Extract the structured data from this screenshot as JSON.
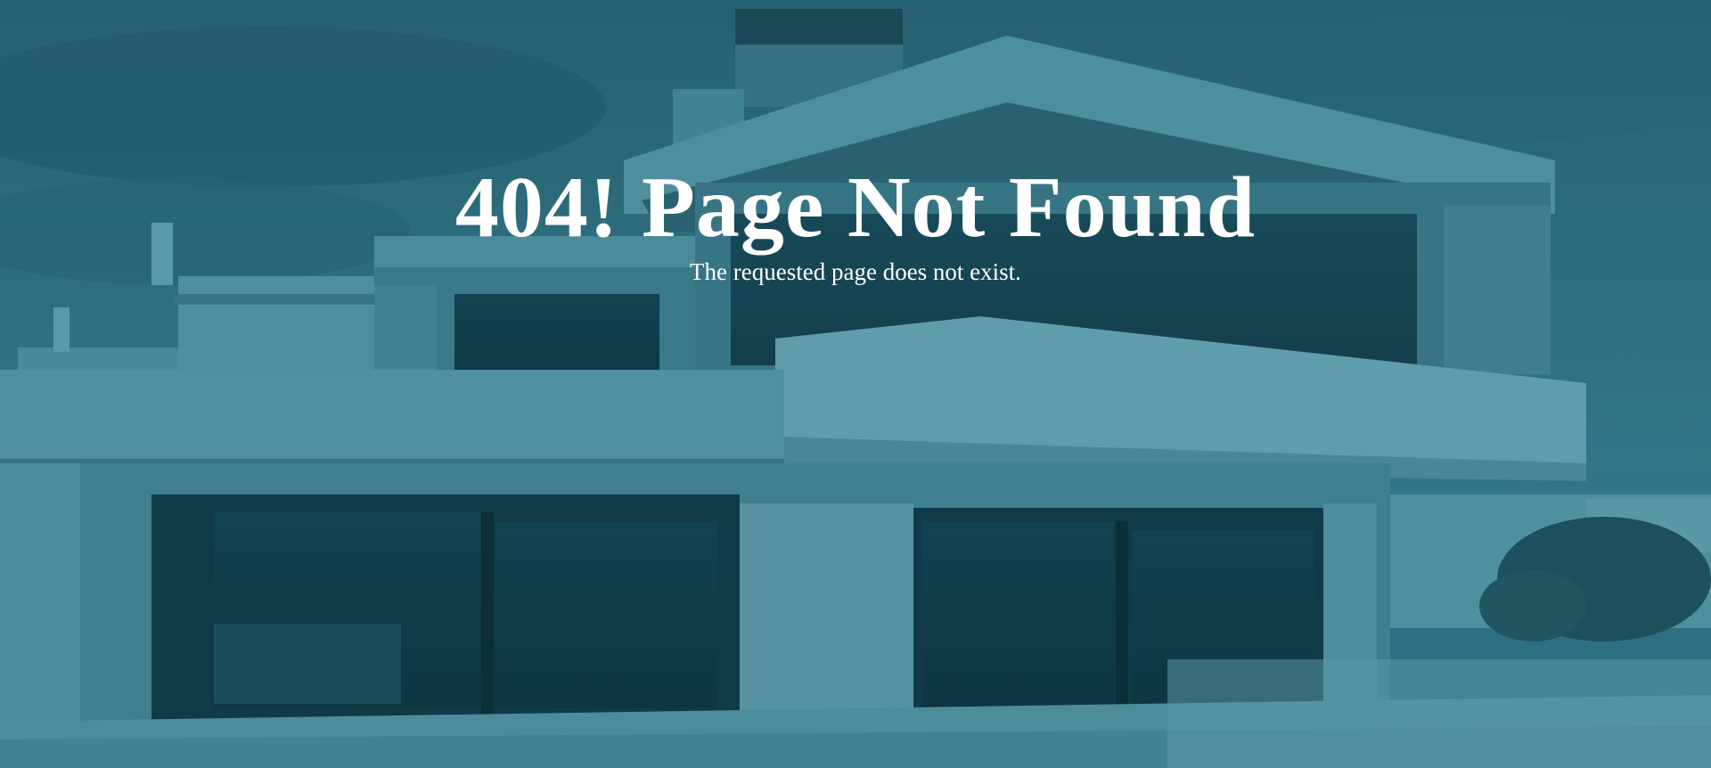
{
  "error_page": {
    "title": "404! Page Not Found",
    "message": "The requested page does not exist."
  },
  "background": {
    "description": "modern house photo",
    "tint_color": "#2e6b7c"
  }
}
